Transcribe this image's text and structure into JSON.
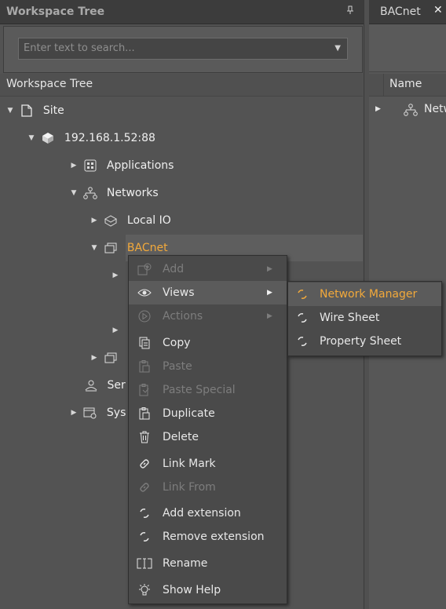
{
  "left_panel": {
    "title": "Workspace Tree",
    "pin_icon": "pin-icon",
    "search_placeholder": "Enter text to search...",
    "column_header": "Workspace Tree"
  },
  "tree": {
    "site": "Site",
    "ip": "192.168.1.52:88",
    "applications": "Applications",
    "networks": "Networks",
    "local_io": "Local IO",
    "bacnet": "BACnet",
    "services_partial": "Ser",
    "system_partial": "Sys"
  },
  "right_panel": {
    "tab_label": "BACnet",
    "close_label": "✕",
    "column_name": "Name",
    "row_partial": "Netw"
  },
  "context_menu": {
    "items": [
      {
        "label": "Add",
        "icon": "add-icon",
        "disabled": true,
        "submenu": true
      },
      {
        "label": "Views",
        "icon": "eye-icon",
        "disabled": false,
        "submenu": true
      },
      {
        "label": "Actions",
        "icon": "play-icon",
        "disabled": true,
        "submenu": true
      },
      {
        "label": "Copy",
        "icon": "copy-icon",
        "disabled": false
      },
      {
        "label": "Paste",
        "icon": "paste-icon",
        "disabled": true
      },
      {
        "label": "Paste Special",
        "icon": "paste-special-icon",
        "disabled": true
      },
      {
        "label": "Duplicate",
        "icon": "duplicate-icon",
        "disabled": false
      },
      {
        "label": "Delete",
        "icon": "trash-icon",
        "disabled": false
      },
      {
        "label": "Link Mark",
        "icon": "link-icon",
        "disabled": false
      },
      {
        "label": "Link From",
        "icon": "link-icon",
        "disabled": true
      },
      {
        "label": "Add extension",
        "icon": "extension-icon",
        "disabled": false
      },
      {
        "label": "Remove extension",
        "icon": "extension-icon",
        "disabled": false
      },
      {
        "label": "Rename",
        "icon": "rename-icon",
        "disabled": false
      },
      {
        "label": "Show Help",
        "icon": "help-icon",
        "disabled": false
      }
    ]
  },
  "views_submenu": {
    "items": [
      {
        "label": "Network Manager",
        "icon": "view-icon",
        "active": true
      },
      {
        "label": "Wire Sheet",
        "icon": "view-icon",
        "active": false
      },
      {
        "label": "Property Sheet",
        "icon": "view-icon",
        "active": false
      }
    ]
  },
  "colors": {
    "accent": "#f2a93b",
    "background": "#505050",
    "header": "#3c3c3c"
  }
}
